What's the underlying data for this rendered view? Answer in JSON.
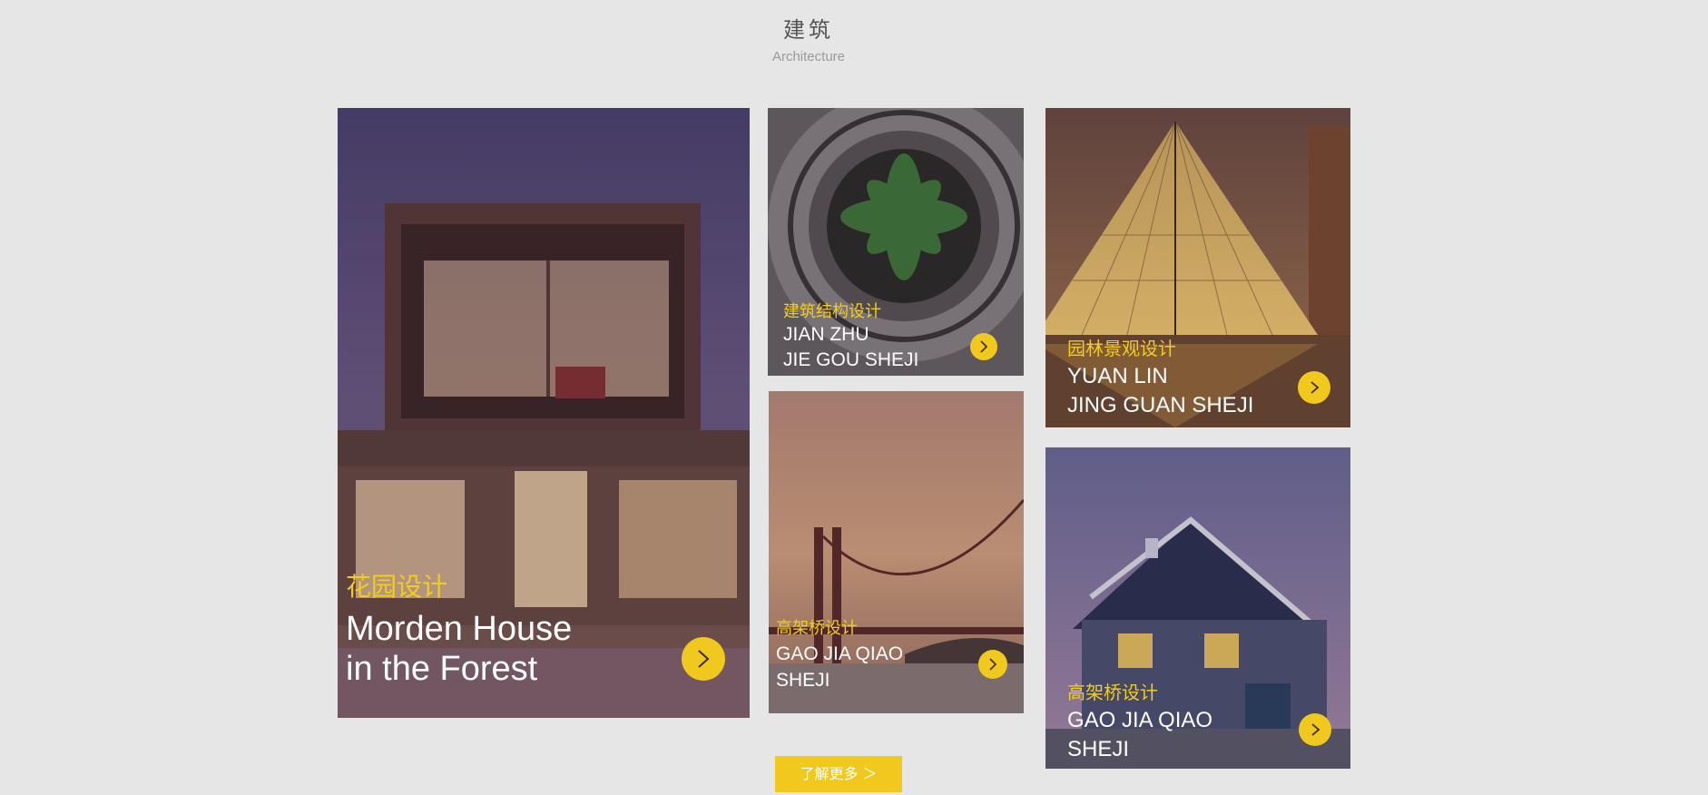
{
  "section": {
    "title_zh": "建筑",
    "title_en": "Architecture"
  },
  "cards": [
    {
      "label_zh": "花园设计",
      "title_line1": "Morden House",
      "title_line2": "in the Forest",
      "icon": "chevron-right-icon"
    },
    {
      "label_zh": "建筑结构设计",
      "title_line1": "JIAN ZHU",
      "title_line2": "JIE GOU SHEJI",
      "icon": "chevron-right-icon"
    },
    {
      "label_zh": "高架桥设计",
      "title_line1": "GAO JIA QIAO",
      "title_line2": "SHEJI",
      "icon": "chevron-right-icon"
    },
    {
      "label_zh": "园林景观设计",
      "title_line1": "YUAN LIN",
      "title_line2": "JING GUAN SHEJI",
      "icon": "chevron-right-icon"
    },
    {
      "label_zh": "高架桥设计",
      "title_line1": "GAO JIA QIAO",
      "title_line2": "SHEJI",
      "icon": "chevron-right-icon"
    }
  ],
  "more_button": {
    "label": "了解更多 ＞"
  },
  "colors": {
    "accent": "#f0c81e",
    "background": "#e6e6e6",
    "label": "#f2cc1f"
  }
}
